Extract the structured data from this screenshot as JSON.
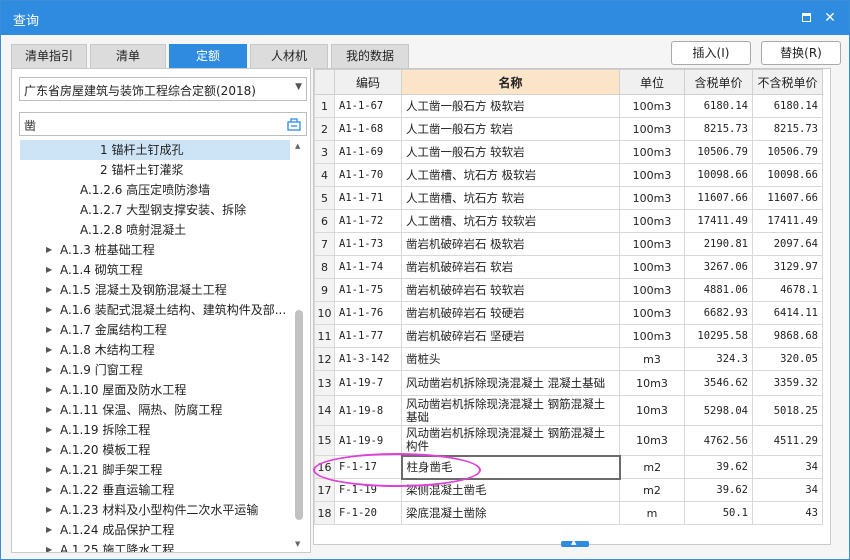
{
  "window": {
    "title": "查询"
  },
  "tabs": [
    {
      "label": "清单指引",
      "active": false
    },
    {
      "label": "清单",
      "active": false
    },
    {
      "label": "定额",
      "active": true
    },
    {
      "label": "人材机",
      "active": false
    },
    {
      "label": "我的数据",
      "active": false
    }
  ],
  "buttons": {
    "insert": "插入(I)",
    "replace": "替换(R)"
  },
  "left": {
    "quota_library": "广东省房屋建筑与装饰工程综合定额(2018)",
    "search_value": "凿",
    "tree": [
      {
        "label": "1 锚杆土钉成孔",
        "arrow": false,
        "selected": true
      },
      {
        "label": "2 锚杆土钉灌浆",
        "arrow": false,
        "selected": false
      },
      {
        "label": "A.1.2.6 高压定喷防渗墙",
        "arrow": false,
        "selected": false
      },
      {
        "label": "A.1.2.7 大型钢支撑安装、拆除",
        "arrow": false,
        "selected": false
      },
      {
        "label": "A.1.2.8 喷射混凝土",
        "arrow": false,
        "selected": false
      },
      {
        "label": "A.1.3 桩基础工程",
        "arrow": true,
        "selected": false
      },
      {
        "label": "A.1.4 砌筑工程",
        "arrow": true,
        "selected": false
      },
      {
        "label": "A.1.5 混凝土及钢筋混凝土工程",
        "arrow": true,
        "selected": false
      },
      {
        "label": "A.1.6 装配式混凝土结构、建筑构件及部...",
        "arrow": true,
        "selected": false
      },
      {
        "label": "A.1.7 金属结构工程",
        "arrow": true,
        "selected": false
      },
      {
        "label": "A.1.8 木结构工程",
        "arrow": true,
        "selected": false
      },
      {
        "label": "A.1.9 门窗工程",
        "arrow": true,
        "selected": false
      },
      {
        "label": "A.1.10 屋面及防水工程",
        "arrow": true,
        "selected": false
      },
      {
        "label": "A.1.11 保温、隔热、防腐工程",
        "arrow": true,
        "selected": false
      },
      {
        "label": "A.1.19 拆除工程",
        "arrow": true,
        "selected": false
      },
      {
        "label": "A.1.20 模板工程",
        "arrow": true,
        "selected": false
      },
      {
        "label": "A.1.21 脚手架工程",
        "arrow": true,
        "selected": false
      },
      {
        "label": "A.1.22 垂直运输工程",
        "arrow": true,
        "selected": false
      },
      {
        "label": "A.1.23 材料及小型构件二次水平运输",
        "arrow": true,
        "selected": false
      },
      {
        "label": "A.1.24 成品保护工程",
        "arrow": true,
        "selected": false
      },
      {
        "label": "A.1.25 施工降水工程",
        "arrow": true,
        "selected": false
      }
    ]
  },
  "grid": {
    "headers": [
      "",
      "编码",
      "名称",
      "单位",
      "含税单价",
      "不含税单价"
    ],
    "rows": [
      {
        "idx": "1",
        "code": "A1-1-67",
        "name": "人工凿一般石方 极软岩",
        "unit": "100m3",
        "tax": "6180.14",
        "notax": "6180.14"
      },
      {
        "idx": "2",
        "code": "A1-1-68",
        "name": "人工凿一般石方 软岩",
        "unit": "100m3",
        "tax": "8215.73",
        "notax": "8215.73"
      },
      {
        "idx": "3",
        "code": "A1-1-69",
        "name": "人工凿一般石方 较软岩",
        "unit": "100m3",
        "tax": "10506.79",
        "notax": "10506.79"
      },
      {
        "idx": "4",
        "code": "A1-1-70",
        "name": "人工凿槽、坑石方 极软岩",
        "unit": "100m3",
        "tax": "10098.66",
        "notax": "10098.66"
      },
      {
        "idx": "5",
        "code": "A1-1-71",
        "name": "人工凿槽、坑石方 软岩",
        "unit": "100m3",
        "tax": "11607.66",
        "notax": "11607.66"
      },
      {
        "idx": "6",
        "code": "A1-1-72",
        "name": "人工凿槽、坑石方 较软岩",
        "unit": "100m3",
        "tax": "17411.49",
        "notax": "17411.49"
      },
      {
        "idx": "7",
        "code": "A1-1-73",
        "name": "凿岩机破碎岩石 极软岩",
        "unit": "100m3",
        "tax": "2190.81",
        "notax": "2097.64"
      },
      {
        "idx": "8",
        "code": "A1-1-74",
        "name": "凿岩机破碎岩石 软岩",
        "unit": "100m3",
        "tax": "3267.06",
        "notax": "3129.97"
      },
      {
        "idx": "9",
        "code": "A1-1-75",
        "name": "凿岩机破碎岩石 较软岩",
        "unit": "100m3",
        "tax": "4881.06",
        "notax": "4678.1"
      },
      {
        "idx": "10",
        "code": "A1-1-76",
        "name": "凿岩机破碎岩石 较硬岩",
        "unit": "100m3",
        "tax": "6682.93",
        "notax": "6414.11"
      },
      {
        "idx": "11",
        "code": "A1-1-77",
        "name": "凿岩机破碎岩石 坚硬岩",
        "unit": "100m3",
        "tax": "10295.58",
        "notax": "9868.68"
      },
      {
        "idx": "12",
        "code": "A1-3-142",
        "name": "凿桩头",
        "unit": "m3",
        "tax": "324.3",
        "notax": "320.05"
      },
      {
        "idx": "13",
        "code": "A1-19-7",
        "name": "风动凿岩机拆除现浇混凝土 混凝土基础",
        "unit": "10m3",
        "tax": "3546.62",
        "notax": "3359.32"
      },
      {
        "idx": "14",
        "code": "A1-19-8",
        "name": "风动凿岩机拆除现浇混凝土 钢筋混凝土基础",
        "unit": "10m3",
        "tax": "5298.04",
        "notax": "5018.25"
      },
      {
        "idx": "15",
        "code": "A1-19-9",
        "name": "风动凿岩机拆除现浇混凝土 钢筋混凝土构件",
        "unit": "10m3",
        "tax": "4762.56",
        "notax": "4511.29"
      },
      {
        "idx": "16",
        "code": "F-1-17",
        "name": "柱身凿毛",
        "unit": "m2",
        "tax": "39.62",
        "notax": "34"
      },
      {
        "idx": "17",
        "code": "F-1-19",
        "name": "梁侧混凝土凿毛",
        "unit": "m2",
        "tax": "39.62",
        "notax": "34"
      },
      {
        "idx": "18",
        "code": "F-1-20",
        "name": "梁底混凝土凿除",
        "unit": "m",
        "tax": "50.1",
        "notax": "43"
      }
    ]
  },
  "colors": {
    "accent": "#2e8be0",
    "highlight_ellipse": "#e040d8",
    "header_name_bg": "#fbe4c8"
  }
}
